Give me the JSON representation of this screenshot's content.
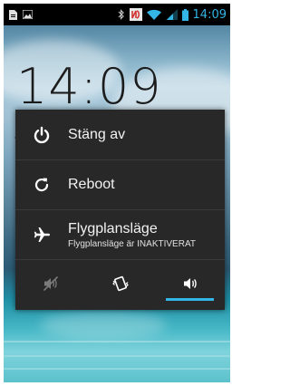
{
  "status_bar": {
    "time": "14:09",
    "icons": [
      "notification-icon",
      "image-icon",
      "bluetooth-icon",
      "nfc-icon",
      "wifi-icon",
      "signal-icon",
      "battery-icon"
    ]
  },
  "lockscreen": {
    "clock": "14:09",
    "clock_stub": "t"
  },
  "power_menu": {
    "items": [
      {
        "label": "Stäng av",
        "icon": "power-icon"
      },
      {
        "label": "Reboot",
        "icon": "reboot-icon"
      },
      {
        "label": "Flygplansläge",
        "sublabel": "Flygplansläge är INAKTIVERAT",
        "icon": "airplane-icon"
      }
    ],
    "modes": [
      {
        "icon": "silent-icon",
        "selected": false
      },
      {
        "icon": "vibrate-icon",
        "selected": false
      },
      {
        "icon": "sound-on-icon",
        "selected": true
      }
    ]
  },
  "colors": {
    "accent": "#33b5e5",
    "dialog_bg": "#282828",
    "status_bar_bg": "#000000"
  }
}
